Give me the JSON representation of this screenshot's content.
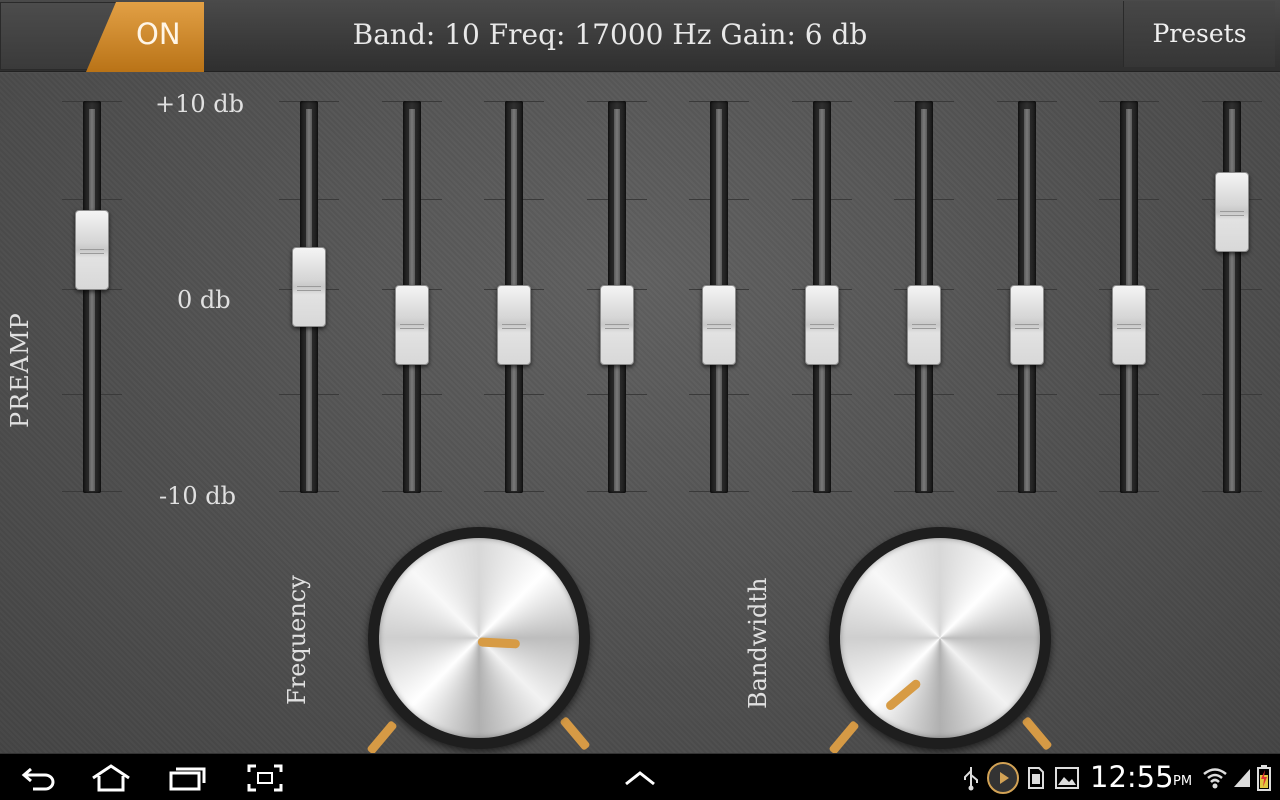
{
  "topbar": {
    "power_label": "ON",
    "status_text": "Band: 10 Freq: 17000 Hz Gain: 6 db",
    "presets_label": "Presets"
  },
  "scale": {
    "top": "+10 db",
    "mid": "0 db",
    "bottom": "-10 db"
  },
  "preamp": {
    "label": "PREAMP",
    "gain_db": 4
  },
  "bands": [
    {
      "band": 1,
      "gain_db": 2
    },
    {
      "band": 2,
      "gain_db": 0
    },
    {
      "band": 3,
      "gain_db": 0
    },
    {
      "band": 4,
      "gain_db": 0
    },
    {
      "band": 5,
      "gain_db": 0
    },
    {
      "band": 6,
      "gain_db": 0
    },
    {
      "band": 7,
      "gain_db": 0
    },
    {
      "band": 8,
      "gain_db": 0
    },
    {
      "band": 9,
      "gain_db": 0
    },
    {
      "band": 10,
      "gain_db": 6
    }
  ],
  "knobs": {
    "frequency_label": "Frequency",
    "bandwidth_label": "Bandwidth"
  },
  "colors": {
    "accent": "#d79b44",
    "background": "#505050",
    "topbar": "#3a3a3a"
  },
  "navbar": {
    "clock": "12:55",
    "ampm": "PM",
    "icons": [
      "back-icon",
      "home-icon",
      "recent-apps-icon",
      "screenshot-icon",
      "up-chevron-icon",
      "usb-icon",
      "media-play-icon",
      "sd-card-icon",
      "gallery-icon",
      "wifi-icon",
      "signal-icon",
      "battery-icon"
    ]
  }
}
